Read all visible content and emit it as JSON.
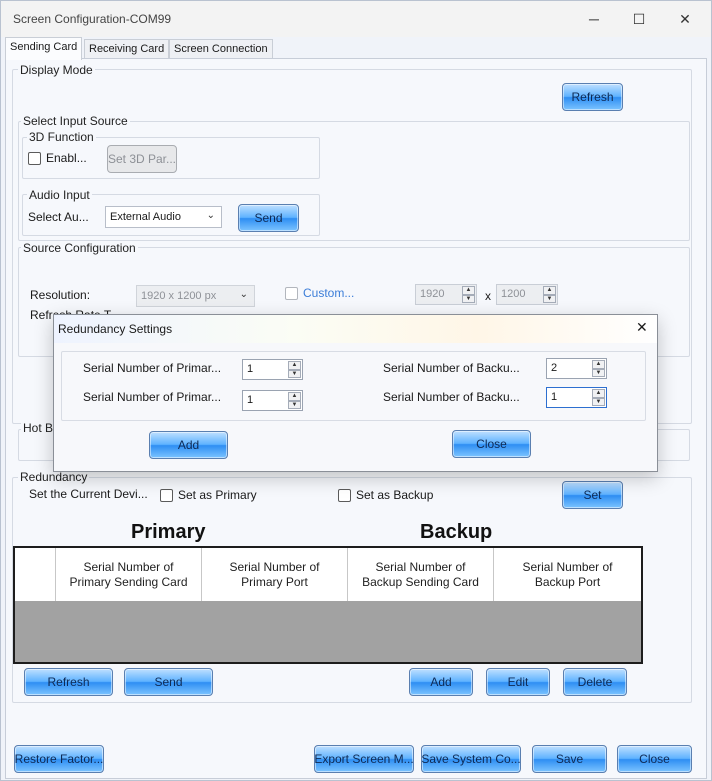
{
  "window": {
    "title": "Screen Configuration-COM99",
    "minimize_icon": "minimize-icon",
    "maximize_icon": "maximize-icon",
    "close_icon": "close-icon",
    "min_glyph": "─",
    "max_glyph": "☐",
    "close_glyph": "✕"
  },
  "tabs": [
    "Sending Card",
    "Receiving Card",
    "Screen Connection"
  ],
  "display_mode": {
    "label": "Display Mode",
    "refresh": "Refresh"
  },
  "input_source": {
    "label": "Select Input Source",
    "function_3d": {
      "label": "3D Function",
      "enable": "Enabl...",
      "set_params": "Set 3D Par..."
    },
    "audio": {
      "label": "Audio Input",
      "select_label": "Select Au...",
      "selected": "External Audio",
      "send": "Send"
    }
  },
  "source_config": {
    "label": "Source Configuration",
    "resolution_label": "Resolution:",
    "resolution_value": "1920 x 1200 px",
    "custom_label": "Custom...",
    "width": "1920",
    "x_sep": "x",
    "height": "1200",
    "refresh_rate_label": "Refresh Rate T..."
  },
  "hot_backup": {
    "label": "Hot B..."
  },
  "redundancy": {
    "label": "Redundancy",
    "current_device": "Set the Current Devi...",
    "set_primary": "Set as Primary",
    "set_backup": "Set as Backup",
    "set": "Set",
    "primary_heading": "Primary",
    "backup_heading": "Backup",
    "columns": [
      "Serial Number of Primary Sending Card",
      "Serial Number of Primary Port",
      "Serial Number of Backup Sending Card",
      "Serial Number of Backup Port"
    ],
    "refresh": "Refresh",
    "send": "Send",
    "add": "Add",
    "edit": "Edit",
    "delete": "Delete"
  },
  "footer": {
    "restore": "Restore Factor...",
    "export": "Export Screen M...",
    "save_system": "Save System Co...",
    "save": "Save",
    "close": "Close"
  },
  "dialog": {
    "title": "Redundancy Settings",
    "close_glyph": "✕",
    "primary_card_label": "Serial Number of Primar...",
    "primary_card_value": "1",
    "primary_port_label": "Serial Number of Primar...",
    "primary_port_value": "1",
    "backup_card_label": "Serial Number of Backu...",
    "backup_card_value": "2",
    "backup_port_label": "Serial Number of Backu...",
    "backup_port_value": "1",
    "add": "Add",
    "close": "Close"
  },
  "colors": {
    "button_blue": "#2e8ef3",
    "table_body_gray": "#a2a2a2"
  }
}
